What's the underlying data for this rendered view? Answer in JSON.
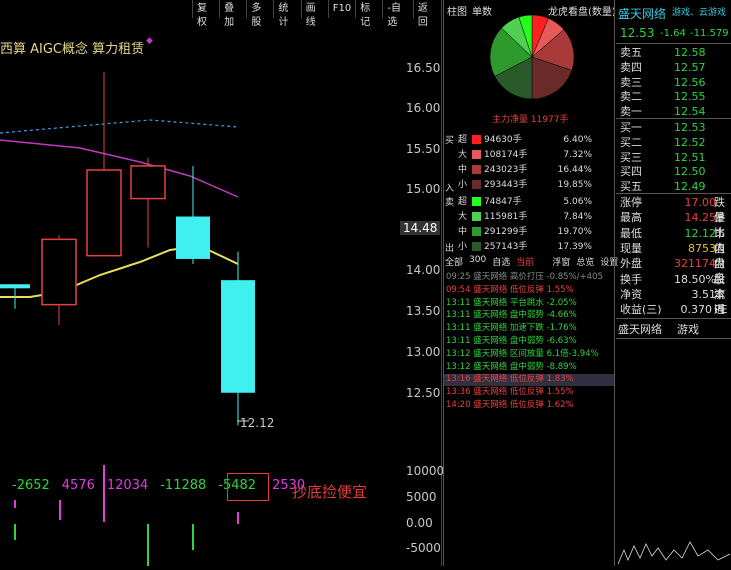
{
  "toolbar": [
    "复权",
    "叠加",
    "多股",
    "统计",
    "画线",
    "F10",
    "标记",
    "-自选",
    "返回"
  ],
  "concept": "西算 AIGC概念 算力租赁",
  "price_axis": [
    "16.50",
    "16.00",
    "15.50",
    "15.00",
    "14.48",
    "14.00",
    "13.50",
    "13.00",
    "12.50"
  ],
  "vol_axis": [
    "10000",
    "5000",
    "0.00",
    "-5000"
  ],
  "low_label": "12.12",
  "vol_values": [
    {
      "v": "-2652",
      "c": "#2fd43c"
    },
    {
      "v": "4576",
      "c": "#e33be0"
    },
    {
      "v": "12034",
      "c": "#e33be0"
    },
    {
      "v": "-11288",
      "c": "#2fd43c"
    },
    {
      "v": "-5482",
      "c": "#2fd43c"
    },
    {
      "v": "2530",
      "c": "#e33be0"
    }
  ],
  "trend_text": "抄底捡便宜",
  "mid": {
    "tab1": "柱图",
    "tab2": "单数",
    "title": "龙虎看盘(数量)",
    "netflow": "主力净量 11977手",
    "buy_label": "买",
    "sell_label": "卖",
    "in_label": "入",
    "out_label": "出",
    "flows": [
      {
        "size": "超",
        "lots": "94630手",
        "pct": "6.40%",
        "color": "#ff2020"
      },
      {
        "size": "大",
        "lots": "108174手",
        "pct": "7.32%",
        "color": "#e85a5a"
      },
      {
        "size": "中",
        "lots": "243023手",
        "pct": "16.44%",
        "color": "#a83a3a"
      },
      {
        "size": "小",
        "lots": "293443手",
        "pct": "19.85%",
        "color": "#6a2a2a"
      },
      {
        "size": "超",
        "lots": "74847手",
        "pct": "5.06%",
        "color": "#20ff20"
      },
      {
        "size": "大",
        "lots": "115981手",
        "pct": "7.84%",
        "color": "#50d050"
      },
      {
        "size": "中",
        "lots": "291299手",
        "pct": "19.70%",
        "color": "#2e9a2e"
      },
      {
        "size": "小",
        "lots": "257143手",
        "pct": "17.39%",
        "color": "#2a5a2a"
      }
    ],
    "market_tabs": [
      "全部",
      "300",
      "自选",
      "当前",
      "浮窗",
      "总览",
      "设置"
    ],
    "alerts": [
      {
        "t": "09:25",
        "name": "盛天网络",
        "type": "高价打压",
        "val": "-0.85%/+405",
        "c": "#888"
      },
      {
        "t": "09:54",
        "name": "盛天网络",
        "type": "低位反弹",
        "val": "1.55%",
        "c": "#e84040"
      },
      {
        "t": "13:11",
        "name": "盛天网络",
        "type": "平台跳水",
        "val": "-2.05%",
        "c": "#2fd43c"
      },
      {
        "t": "13:11",
        "name": "盛天网络",
        "type": "盘中弱势",
        "val": "-4.66%",
        "c": "#2fd43c"
      },
      {
        "t": "13:11",
        "name": "盛天网络",
        "type": "加速下跌",
        "val": "-1.76%",
        "c": "#2fd43c"
      },
      {
        "t": "13:11",
        "name": "盛天网络",
        "type": "盘中弱势",
        "val": "-6.63%",
        "c": "#2fd43c"
      },
      {
        "t": "13:12",
        "name": "盛天网络",
        "type": "区间放量",
        "val": "6.1倍-3.94%",
        "c": "#2fd43c"
      },
      {
        "t": "13:12",
        "name": "盛天网络",
        "type": "盘中弱势",
        "val": "-8.89%",
        "c": "#2fd43c"
      },
      {
        "t": "13:16",
        "name": "盛天网络",
        "type": "低位反弹",
        "val": "1.83%",
        "c": "#e84040"
      },
      {
        "t": "13:36",
        "name": "盛天网络",
        "type": "低位反弹",
        "val": "1.55%",
        "c": "#e84040"
      },
      {
        "t": "14:20",
        "name": "盛天网络",
        "type": "低位反弹",
        "val": "1.62%",
        "c": "#e84040"
      }
    ]
  },
  "right": {
    "stock": "盛天网络",
    "tags": "游戏、云游戏",
    "price": "12.53",
    "chg": "-1.64",
    "pct": "-11.579",
    "sells": [
      {
        "l": "卖五",
        "p": "12.58"
      },
      {
        "l": "卖四",
        "p": "12.57"
      },
      {
        "l": "卖三",
        "p": "12.56"
      },
      {
        "l": "卖二",
        "p": "12.55"
      },
      {
        "l": "卖一",
        "p": "12.54"
      }
    ],
    "buys": [
      {
        "l": "买一",
        "p": "12.53"
      },
      {
        "l": "买二",
        "p": "12.52"
      },
      {
        "l": "买三",
        "p": "12.51"
      },
      {
        "l": "买四",
        "p": "12.50"
      },
      {
        "l": "买五",
        "p": "12.49"
      }
    ],
    "stats": [
      {
        "l": "涨停",
        "v": "17.00",
        "c": "#e84040",
        "r": "跌停"
      },
      {
        "l": "最高",
        "v": "14.25",
        "c": "#e84040",
        "r": "量比"
      },
      {
        "l": "最低",
        "v": "12.12",
        "c": "#2fd43c",
        "r": "市值"
      },
      {
        "l": "现量",
        "v": "8753",
        "c": "#e0c030",
        "r": "内盘"
      },
      {
        "l": "外盘",
        "v": "321174",
        "c": "#e84040",
        "r": "内盘"
      },
      {
        "l": "换手",
        "v": "18.50%",
        "c": "#ddd",
        "r": "股本"
      },
      {
        "l": "净资",
        "v": "3.51",
        "c": "#ddd",
        "r": "流通"
      },
      {
        "l": "收益(三)",
        "v": "0.370",
        "c": "#ddd",
        "r": "PE"
      }
    ],
    "footer1": "盛天网络",
    "footer2": "游戏"
  },
  "chart_data": {
    "type": "candlestick",
    "candles": [
      {
        "o": 13.85,
        "c": 13.8,
        "h": 13.85,
        "l": 13.55,
        "up": false
      },
      {
        "o": 13.6,
        "c": 14.4,
        "h": 14.45,
        "l": 13.35,
        "up": true
      },
      {
        "o": 14.2,
        "c": 15.25,
        "h": 16.45,
        "l": 14.2,
        "up": true
      },
      {
        "o": 14.9,
        "c": 15.3,
        "h": 15.4,
        "l": 14.3,
        "up": true
      },
      {
        "o": 14.68,
        "c": 14.16,
        "h": 15.3,
        "l": 14.1,
        "up": false
      },
      {
        "o": 13.9,
        "c": 12.52,
        "h": 14.25,
        "l": 12.12,
        "up": false
      }
    ],
    "ylim": [
      12.0,
      16.8
    ]
  }
}
